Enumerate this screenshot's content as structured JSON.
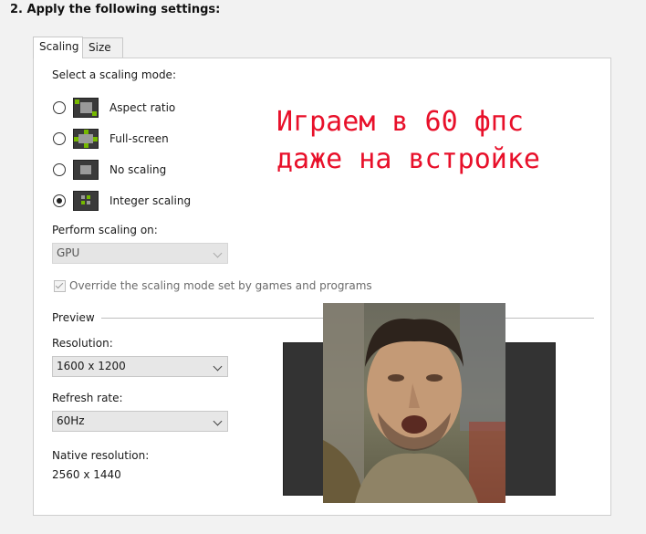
{
  "header": {
    "section_title": "2. Apply the following settings:"
  },
  "tabs": [
    {
      "label": "Scaling",
      "active": true
    },
    {
      "label": "Size",
      "active": false
    }
  ],
  "scaling": {
    "prompt": "Select a scaling mode:",
    "modes": [
      {
        "label": "Aspect ratio",
        "selected": false,
        "icon": "aspect-ratio-icon"
      },
      {
        "label": "Full-screen",
        "selected": false,
        "icon": "full-screen-icon"
      },
      {
        "label": "No scaling",
        "selected": false,
        "icon": "no-scaling-icon"
      },
      {
        "label": "Integer scaling",
        "selected": true,
        "icon": "integer-scaling-icon"
      }
    ],
    "perform_label": "Perform scaling on:",
    "perform_value": "GPU",
    "override_label": "Override the scaling mode set by games and programs",
    "override_checked": true
  },
  "preview": {
    "title": "Preview",
    "resolution_label": "Resolution:",
    "resolution_value": "1600 x 1200",
    "refresh_label": "Refresh rate:",
    "refresh_value": "60Hz",
    "native_label": "Native resolution:",
    "native_value": "2560 x 1440"
  },
  "overlay": {
    "line1": "Играем в 60 фпс",
    "line2": "даже на встройке",
    "color": "#e8102a"
  },
  "colors": {
    "nvidia_green": "#76b900"
  }
}
